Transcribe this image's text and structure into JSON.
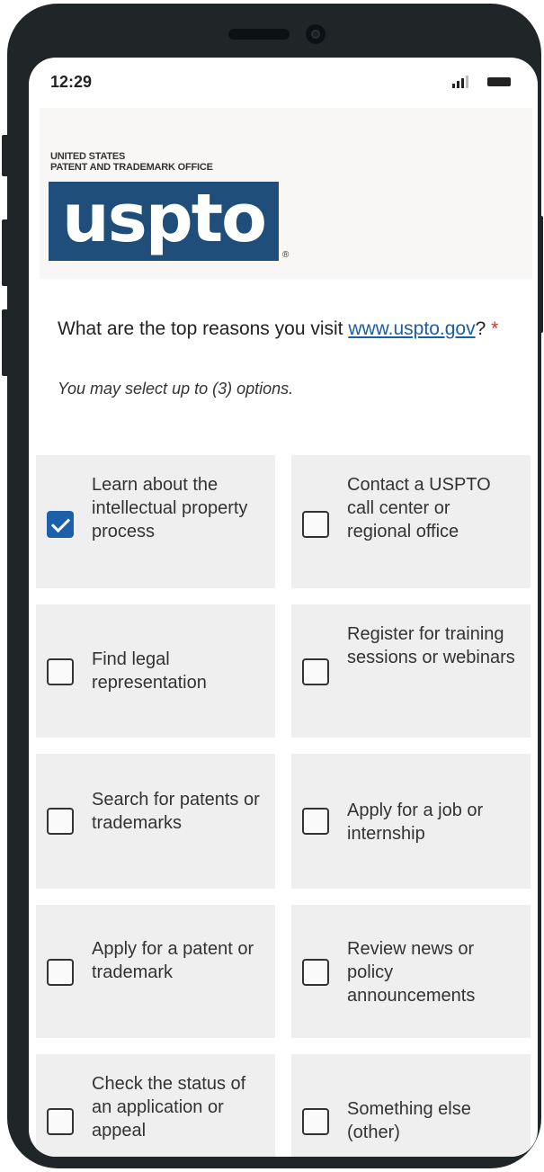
{
  "status_bar": {
    "time": "12:29"
  },
  "header": {
    "org_line1": "UNITED STATES",
    "org_line2": "PATENT AND TRADEMARK OFFICE",
    "logo_text": "uspto",
    "reg_mark": "®"
  },
  "question": {
    "text_before": "What are the top reasons you visit ",
    "link": "www.uspto.gov",
    "text_after": "? ",
    "required_marker": "*",
    "instruction": "You may select up to (3) options."
  },
  "options": [
    {
      "label": "Learn about the intellectual property process",
      "checked": true
    },
    {
      "label": "Contact a USPTO call center or regional office",
      "checked": false
    },
    {
      "label": "Find legal representation",
      "checked": false
    },
    {
      "label": "Register for training sessions or webinars",
      "checked": false
    },
    {
      "label": "Search for patents or trademarks",
      "checked": false
    },
    {
      "label": "Apply for a job or internship",
      "checked": false
    },
    {
      "label": "Apply for a patent or trademark",
      "checked": false
    },
    {
      "label": "Review news or policy announcements",
      "checked": false
    },
    {
      "label": "Check the status of an application or appeal",
      "checked": false
    },
    {
      "label": "Something else (other)",
      "checked": false
    }
  ],
  "colors": {
    "brand_blue": "#1e4e79",
    "link_blue": "#1a5ea8",
    "checkbox_checked": "#1d5fa8",
    "option_bg": "#efefef",
    "required_red": "#c0392b"
  }
}
